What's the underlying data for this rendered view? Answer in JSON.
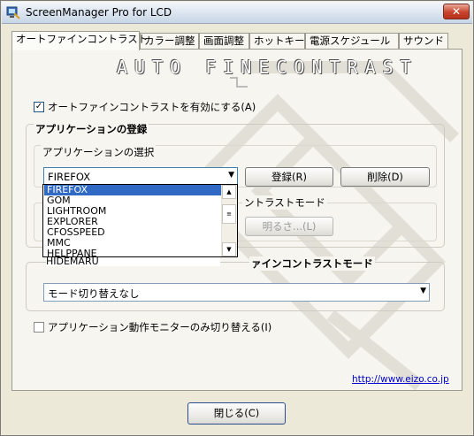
{
  "window": {
    "title": "ScreenManager Pro for LCD",
    "close_label": "✕"
  },
  "tabs": [
    {
      "label": "オートファインコントラスト",
      "active": true
    },
    {
      "label": "カラー調整",
      "active": false
    },
    {
      "label": "画面調整",
      "active": false
    },
    {
      "label": "ホットキー",
      "active": false
    },
    {
      "label": "電源スケジュール",
      "active": false
    },
    {
      "label": "サウンド",
      "active": false
    }
  ],
  "banner": {
    "text": "AUTO FINECONTRAST"
  },
  "enable_checkbox": {
    "label": "オートファインコントラストを有効にする(A)",
    "checked": true
  },
  "app_registration": {
    "legend": "アプリケーションの登録",
    "select_legend": "アプリケーションの選択",
    "selected_app": "FIREFOX",
    "register_label": "登録(R)",
    "delete_label": "削除(D)",
    "dropdown_items": [
      "FIREFOX",
      "GOM",
      "LIGHTROOM",
      "EXPLORER",
      "CFOSSPEED",
      "MMC",
      "HELPPANE",
      "HIDEMARU"
    ],
    "mode_legend_partial": "ントラストモード",
    "brightness_label": "明るさ...(L)"
  },
  "unregistered": {
    "legend": "未登録のアプリケーション使用時のファインコントラストモード",
    "legend_visible_part": "ァインコントラストモード",
    "mode_value": "モード切り替えなし"
  },
  "monitor_checkbox": {
    "label": "アプリケーション動作モニターのみ切り替える(I)",
    "checked": false
  },
  "link": "http://www.eizo.co.jp",
  "close_button": "閉じる(C)"
}
